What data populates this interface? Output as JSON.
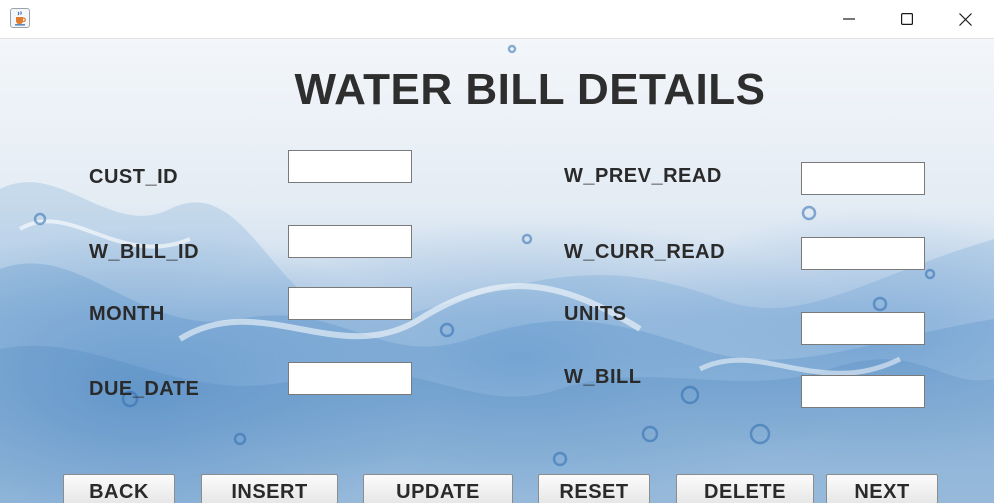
{
  "window": {
    "title": "",
    "controls": {
      "minimize": "minimize",
      "maximize": "maximize",
      "close": "close"
    }
  },
  "form": {
    "title": "WATER BILL DETAILS",
    "left_labels": {
      "cust_id": "CUST_ID",
      "w_bill_id": "W_BILL_ID",
      "month": "MONTH",
      "due_date": "DUE_DATE"
    },
    "right_labels": {
      "w_prev_read": "W_PREV_READ",
      "w_curr_read": "W_CURR_READ",
      "units": "UNITS",
      "w_bill": "W_BILL"
    },
    "values": {
      "cust_id": "",
      "w_bill_id": "",
      "month": "",
      "due_date": "",
      "w_prev_read": "",
      "w_curr_read": "",
      "units": "",
      "w_bill": ""
    }
  },
  "buttons": {
    "back": "BACK",
    "insert": "INSERT",
    "update": "UPDATE",
    "reset": "RESET",
    "delete": "DELETE",
    "next": "NEXT"
  },
  "icons": {
    "app": "java-coffee-cup-icon",
    "minimize": "minimize-icon",
    "maximize": "maximize-icon",
    "close": "close-icon"
  },
  "colors": {
    "title_text": "#2e2e2e",
    "label_text": "#2a2a2a",
    "water_blue": "#4f8cc9",
    "field_border": "#7a7a7a"
  }
}
